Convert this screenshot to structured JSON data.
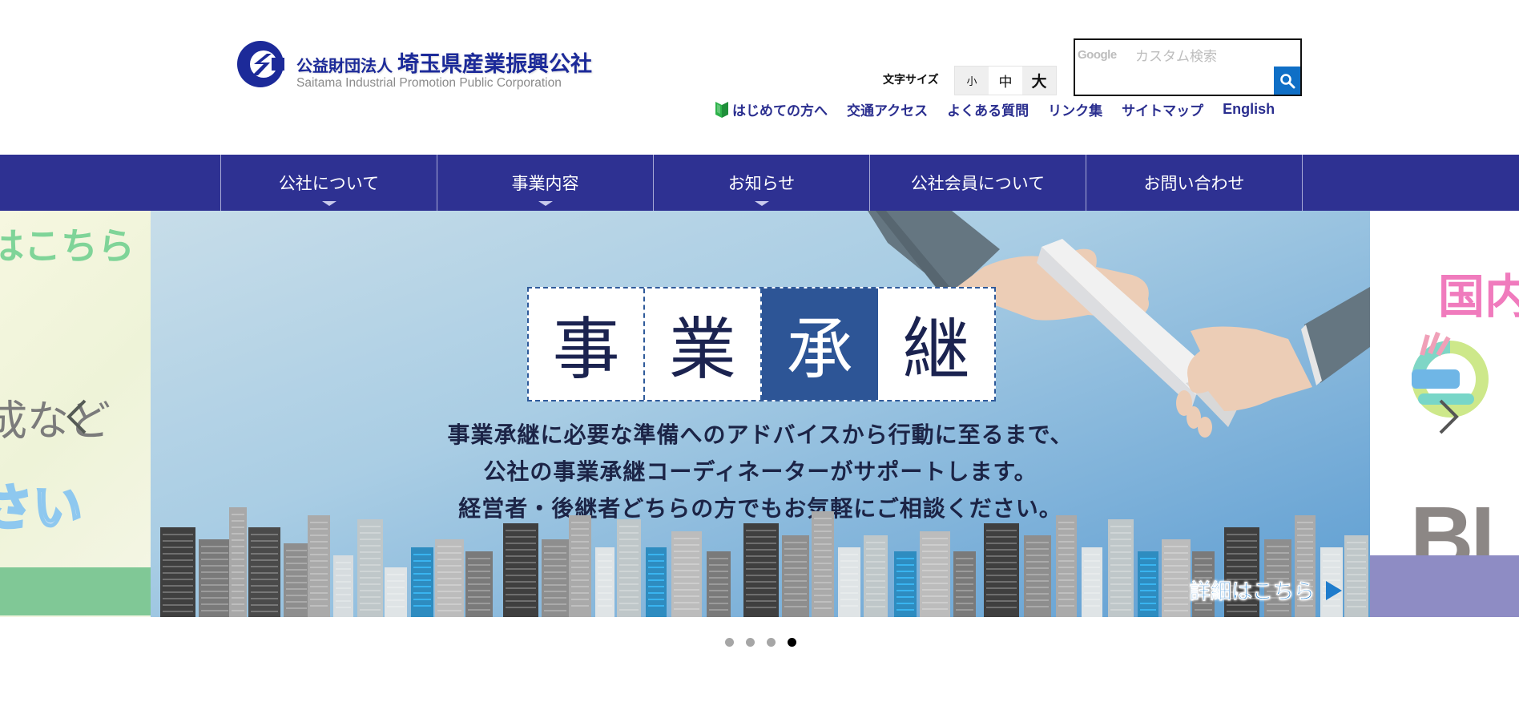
{
  "header": {
    "logo": {
      "org_type": "公益財団法人",
      "org_name": "埼玉県産業振興公社",
      "org_name_en": "Saitama Industrial Promotion Public Corporation",
      "icon": "corporation-logo-icon"
    },
    "font_size": {
      "label": "文字サイズ",
      "options": [
        "小",
        "中",
        "大"
      ],
      "selected": "中"
    },
    "search": {
      "brand": "Google",
      "placeholder": "カスタム検索",
      "value": "",
      "button_icon": "search-icon",
      "button_color": "#0f6fc6"
    },
    "utility_links": [
      {
        "label": "はじめての方へ",
        "icon": "beginner-mark-icon"
      },
      {
        "label": "交通アクセス"
      },
      {
        "label": "よくある質問"
      },
      {
        "label": "リンク集"
      },
      {
        "label": "サイトマップ"
      },
      {
        "label": "English"
      }
    ]
  },
  "global_nav": {
    "color": "#2e3192",
    "items": [
      {
        "label": "公社について",
        "has_dropdown": true
      },
      {
        "label": "事業内容",
        "has_dropdown": true
      },
      {
        "label": "お知らせ",
        "has_dropdown": true
      },
      {
        "label": "公社会員について",
        "has_dropdown": false
      },
      {
        "label": "お問い合わせ",
        "has_dropdown": false
      }
    ]
  },
  "slider": {
    "prev_slide": {
      "text_top": "はこちら",
      "text_middle": "成など",
      "text_bottom": "さい"
    },
    "current_slide": {
      "title_chars": [
        "事",
        "業",
        "承",
        "継"
      ],
      "highlight_index": 2,
      "description": [
        "事業承継に必要な準備へのアドバイスから行動に至るまで、",
        "公社の事業承継コーディネーターがサポートします。",
        "経営者・後継者どちらの方でもお気軽にご相談ください。"
      ],
      "link_label": "詳細はこちら"
    },
    "next_slide": {
      "text_top": "国内最",
      "text_bottom": "BL"
    },
    "prev_arrow_icon": "chevron-left-icon",
    "next_arrow_icon": "chevron-right-icon",
    "dots_count": 4,
    "active_dot": 4
  }
}
